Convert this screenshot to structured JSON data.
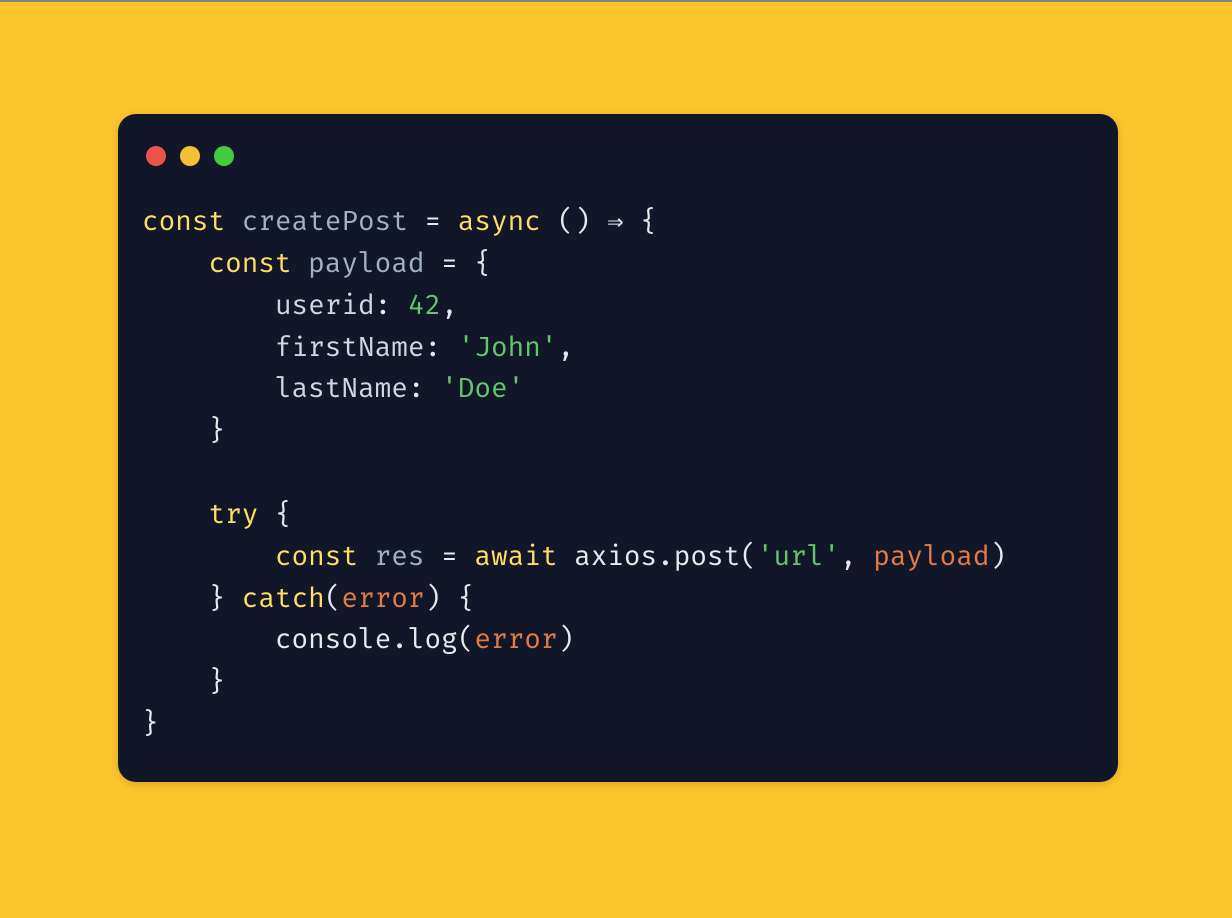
{
  "window": {
    "traffic_light_red": "red",
    "traffic_light_yellow": "yellow",
    "traffic_light_green": "green"
  },
  "code": {
    "kw_const1": "const",
    "id_createPost": "createPost",
    "eq1": "=",
    "kw_async": "async",
    "parens1": "()",
    "arrow": "⇒",
    "brace_open1": "{",
    "kw_const2": "const",
    "id_payload": "payload",
    "eq2": "=",
    "brace_open2": "{",
    "prop_userid": "userid",
    "colon1": ":",
    "num_42": "42",
    "comma1": ",",
    "prop_firstName": "firstName",
    "colon2": ":",
    "str_john": "'John'",
    "comma2": ",",
    "prop_lastName": "lastName",
    "colon3": ":",
    "str_doe": "'Doe'",
    "brace_close2": "}",
    "kw_try": "try",
    "brace_open3": "{",
    "kw_const3": "const",
    "id_res": "res",
    "eq3": "=",
    "kw_await": "await",
    "obj_axios": "axios",
    "dot1": ".",
    "meth_post": "post",
    "paren_open1": "(",
    "str_url": "'url'",
    "comma3": ",",
    "arg_payload": "payload",
    "paren_close1": ")",
    "brace_close3": "}",
    "kw_catch": "catch",
    "paren_open2": "(",
    "id_error": "error",
    "paren_close2": ")",
    "brace_open4": "{",
    "obj_console": "console",
    "dot2": ".",
    "meth_log": "log",
    "paren_open3": "(",
    "id_error2": "error",
    "paren_close3": ")",
    "brace_close4": "}",
    "brace_close1": "}"
  }
}
